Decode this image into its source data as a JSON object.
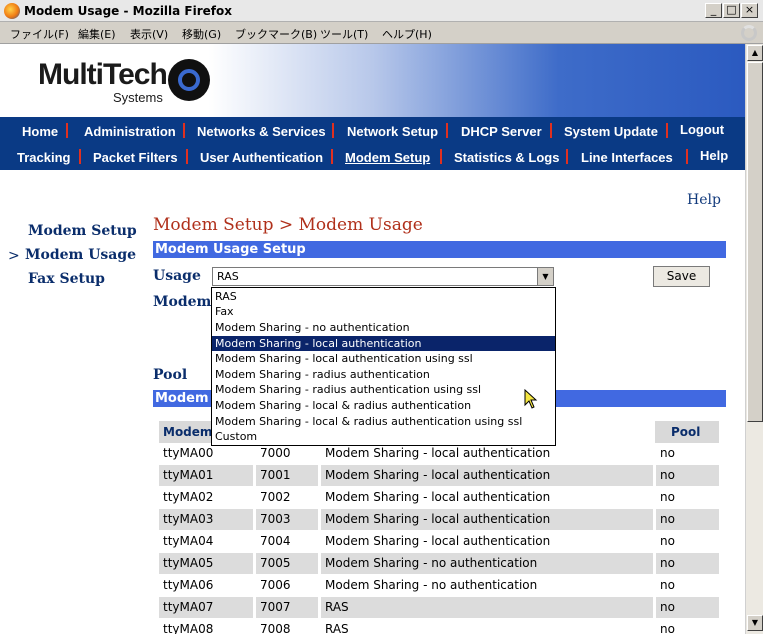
{
  "window": {
    "title": "Modem Usage - Mozilla Firefox"
  },
  "menubar": [
    "ファイル(F)",
    "編集(E)",
    "表示(V)",
    "移動(G)",
    "ブックマーク(B)",
    "ツール(T)",
    "ヘルプ(H)"
  ],
  "logo": {
    "name": "MultiTech",
    "sub": "Systems"
  },
  "nav": {
    "row1": [
      "Home",
      "Administration",
      "Networks & Services",
      "Network Setup",
      "DHCP Server",
      "System Update",
      "Logout"
    ],
    "row2": [
      "Tracking",
      "Packet Filters",
      "User Authentication",
      "Modem Setup",
      "Statistics & Logs",
      "Line Interfaces",
      "Help"
    ]
  },
  "help_link": "Help",
  "sidebar": {
    "arrow": ">",
    "items": [
      "Modem Setup",
      "Modem Usage",
      "Fax Setup"
    ]
  },
  "page_title": "Modem Setup > Modem Usage",
  "setup_section": "Modem Usage Setup",
  "usage": {
    "label": "Usage",
    "value": "RAS",
    "save_label": "Save"
  },
  "modem_label": "Modem",
  "pool_label": "Pool",
  "section2": "Modem",
  "dropdown": {
    "options": [
      "RAS",
      "Fax",
      "Modem Sharing - no authentication",
      "Modem Sharing - local authentication",
      "Modem Sharing - local authentication using ssl",
      "Modem Sharing - radius authentication",
      "Modem Sharing - radius authentication using ssl",
      "Modem Sharing - local & radius authentication",
      "Modem Sharing - local & radius authentication using ssl",
      "Custom"
    ],
    "highlighted": 3
  },
  "table": {
    "headers": {
      "modem": "Modem",
      "pool": "Pool"
    },
    "rows": [
      {
        "modem": "ttyMA00",
        "port": "7000",
        "usage": "Modem Sharing - local authentication",
        "pool": "no"
      },
      {
        "modem": "ttyMA01",
        "port": "7001",
        "usage": "Modem Sharing - local authentication",
        "pool": "no"
      },
      {
        "modem": "ttyMA02",
        "port": "7002",
        "usage": "Modem Sharing - local authentication",
        "pool": "no"
      },
      {
        "modem": "ttyMA03",
        "port": "7003",
        "usage": "Modem Sharing - local authentication",
        "pool": "no"
      },
      {
        "modem": "ttyMA04",
        "port": "7004",
        "usage": "Modem Sharing - local authentication",
        "pool": "no"
      },
      {
        "modem": "ttyMA05",
        "port": "7005",
        "usage": "Modem Sharing - no authentication",
        "pool": "no"
      },
      {
        "modem": "ttyMA06",
        "port": "7006",
        "usage": "Modem Sharing - no authentication",
        "pool": "no"
      },
      {
        "modem": "ttyMA07",
        "port": "7007",
        "usage": "RAS",
        "pool": "no"
      },
      {
        "modem": "ttyMA08",
        "port": "7008",
        "usage": "RAS",
        "pool": "no"
      }
    ]
  },
  "colors": {
    "nav_bg": "#0a3a85",
    "section_bar": "#4169e1",
    "title_red": "#b0301b",
    "link_navy": "#0a2d6b",
    "highlight": "#0a246a"
  }
}
